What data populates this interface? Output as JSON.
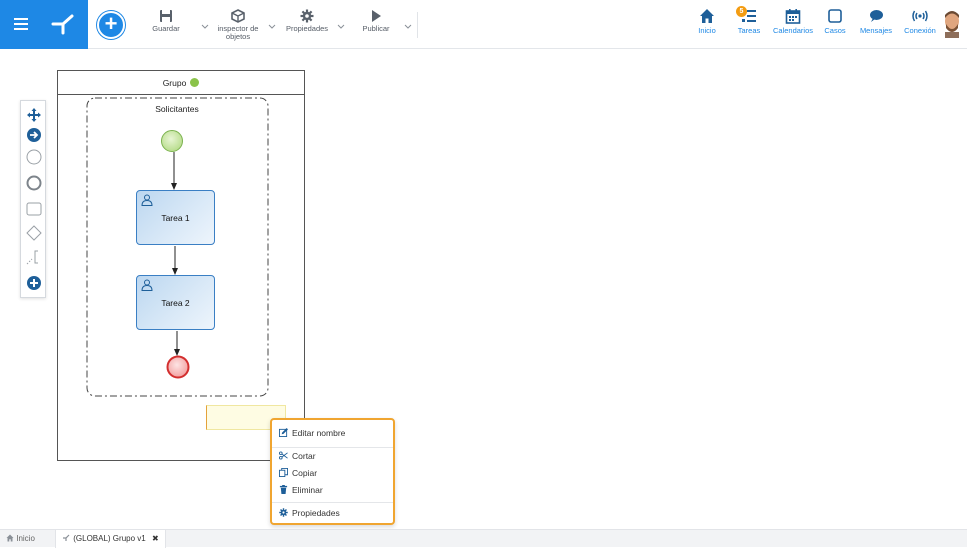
{
  "toolbar": {
    "save_label": "Guardar",
    "inspector_label_1": "inspector de",
    "inspector_label_2": "objetos",
    "properties_label": "Propiedades",
    "publish_label": "Publicar"
  },
  "nav": {
    "home_label": "Inicio",
    "tasks_label": "Tareas",
    "tasks_badge": "5",
    "calendars_label": "Calendarios",
    "cases_label": "Casos",
    "messages_label": "Mensajes",
    "connection_label": "Conexión"
  },
  "diagram": {
    "pool_title": "Grupo",
    "group_label": "Solicitantes",
    "task1_label": "Tarea 1",
    "task2_label": "Tarea 2"
  },
  "context_menu": {
    "edit_name": "Editar nombre",
    "cut": "Cortar",
    "copy": "Copiar",
    "delete": "Eliminar",
    "properties": "Propiedades"
  },
  "bottom_tabs": {
    "home_label": "Inicio",
    "process_tab_label": "(GLOBAL) Grupo v1",
    "close_glyph": "✖"
  },
  "colors": {
    "primary": "#1e88e5",
    "menu_highlight": "#f0a530",
    "start_event": "#8bc34a",
    "end_event": "#e53935"
  }
}
